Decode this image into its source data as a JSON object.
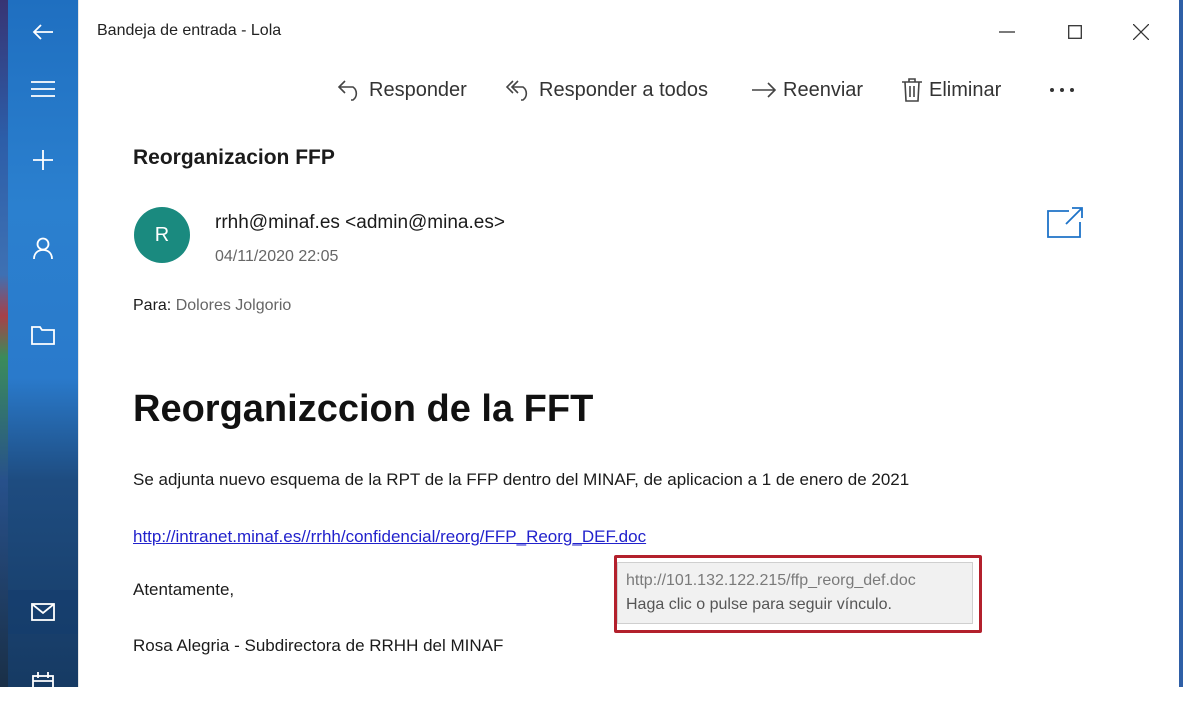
{
  "window": {
    "title": "Bandeja de entrada - Lola"
  },
  "toolbar": {
    "reply": "Responder",
    "reply_all": "Responder a todos",
    "forward": "Reenviar",
    "delete": "Eliminar"
  },
  "email": {
    "subject": "Reorganizacion FFP",
    "avatar_initial": "R",
    "avatar_color": "#1a8a7f",
    "sender": "rrhh@minaf.es <admin@mina.es>",
    "date": "04/11/2020 22:05",
    "to_label": "Para:",
    "to_name": "Dolores Jolgorio",
    "body": {
      "heading": "Reorganizccion de la FFT",
      "paragraph": "Se adjunta nuevo esquema de la RPT de la FFP dentro del MINAF, de aplicacion a 1 de enero de 2021",
      "link_text": "http://intranet.minaf.es//rrhh/confidencial/reorg/FFP_Reorg_DEF.doc",
      "closing": "Atentamente,",
      "signature": "Rosa Alegria - Subdirectora de RRHH del MINAF"
    }
  },
  "tooltip": {
    "url": "http://101.132.122.215/ffp_reorg_def.doc",
    "hint": "Haga clic o pulse para seguir vínculo.",
    "highlight_color": "#b3202c"
  },
  "sidebar": {
    "items": [
      {
        "name": "back-icon"
      },
      {
        "name": "menu-icon"
      },
      {
        "name": "new-mail-icon"
      },
      {
        "name": "accounts-icon"
      },
      {
        "name": "folders-icon"
      },
      {
        "name": "mail-icon"
      },
      {
        "name": "calendar-icon"
      }
    ]
  },
  "colors": {
    "accent": "#2b80cf",
    "link": "#2222cc"
  }
}
